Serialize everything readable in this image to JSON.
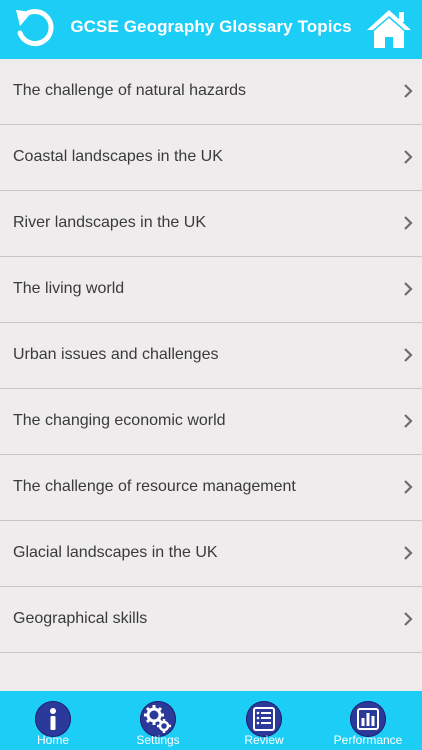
{
  "header": {
    "title": "GCSE Geography Glossary Topics",
    "back_icon": "refresh-back-icon",
    "home_icon": "home-icon",
    "color": "#1ccdf6"
  },
  "topics": [
    {
      "label": "The challenge of natural hazards"
    },
    {
      "label": "Coastal landscapes in the UK"
    },
    {
      "label": "River landscapes in the UK"
    },
    {
      "label": "The living world"
    },
    {
      "label": "Urban issues and challenges"
    },
    {
      "label": "The changing economic world"
    },
    {
      "label": "The challenge of resource management"
    },
    {
      "label": "Glacial landscapes in the UK"
    },
    {
      "label": "Geographical skills"
    }
  ],
  "tabbar": {
    "items": [
      {
        "label": "Home",
        "icon": "info-icon"
      },
      {
        "label": "Settings",
        "icon": "gears-icon"
      },
      {
        "label": "Review",
        "icon": "list-icon"
      },
      {
        "label": "Performance",
        "icon": "bar-chart-icon"
      }
    ]
  },
  "colors": {
    "accent": "#1ccdf6",
    "tab_icon_bg": "#2b3a9a",
    "background": "#efeced"
  }
}
